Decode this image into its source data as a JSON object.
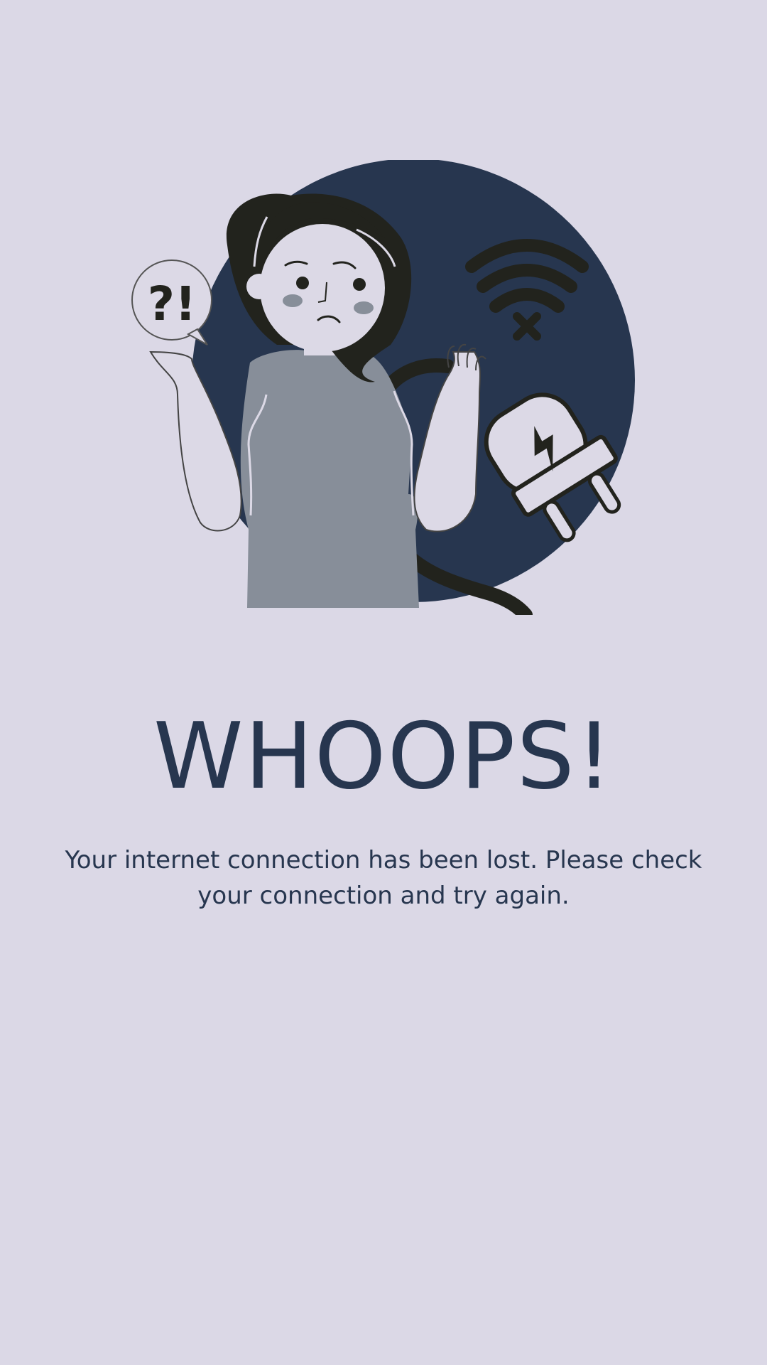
{
  "screen": {
    "title": "WHOOPS!",
    "message": "Your internet connection has been lost. Please check your connection and try again."
  },
  "illustration": {
    "description_icon_names": [
      "person-icon",
      "speech-bubble-icon",
      "wifi-off-icon",
      "plug-icon",
      "cable-icon"
    ],
    "speech_bubble_text": "?!",
    "colors": {
      "background": "#dbd8e6",
      "circle": "#27364f",
      "ink": "#22231d",
      "skin": "#dcd9e6",
      "shirt": "#878e99",
      "text": "#27364f"
    }
  }
}
